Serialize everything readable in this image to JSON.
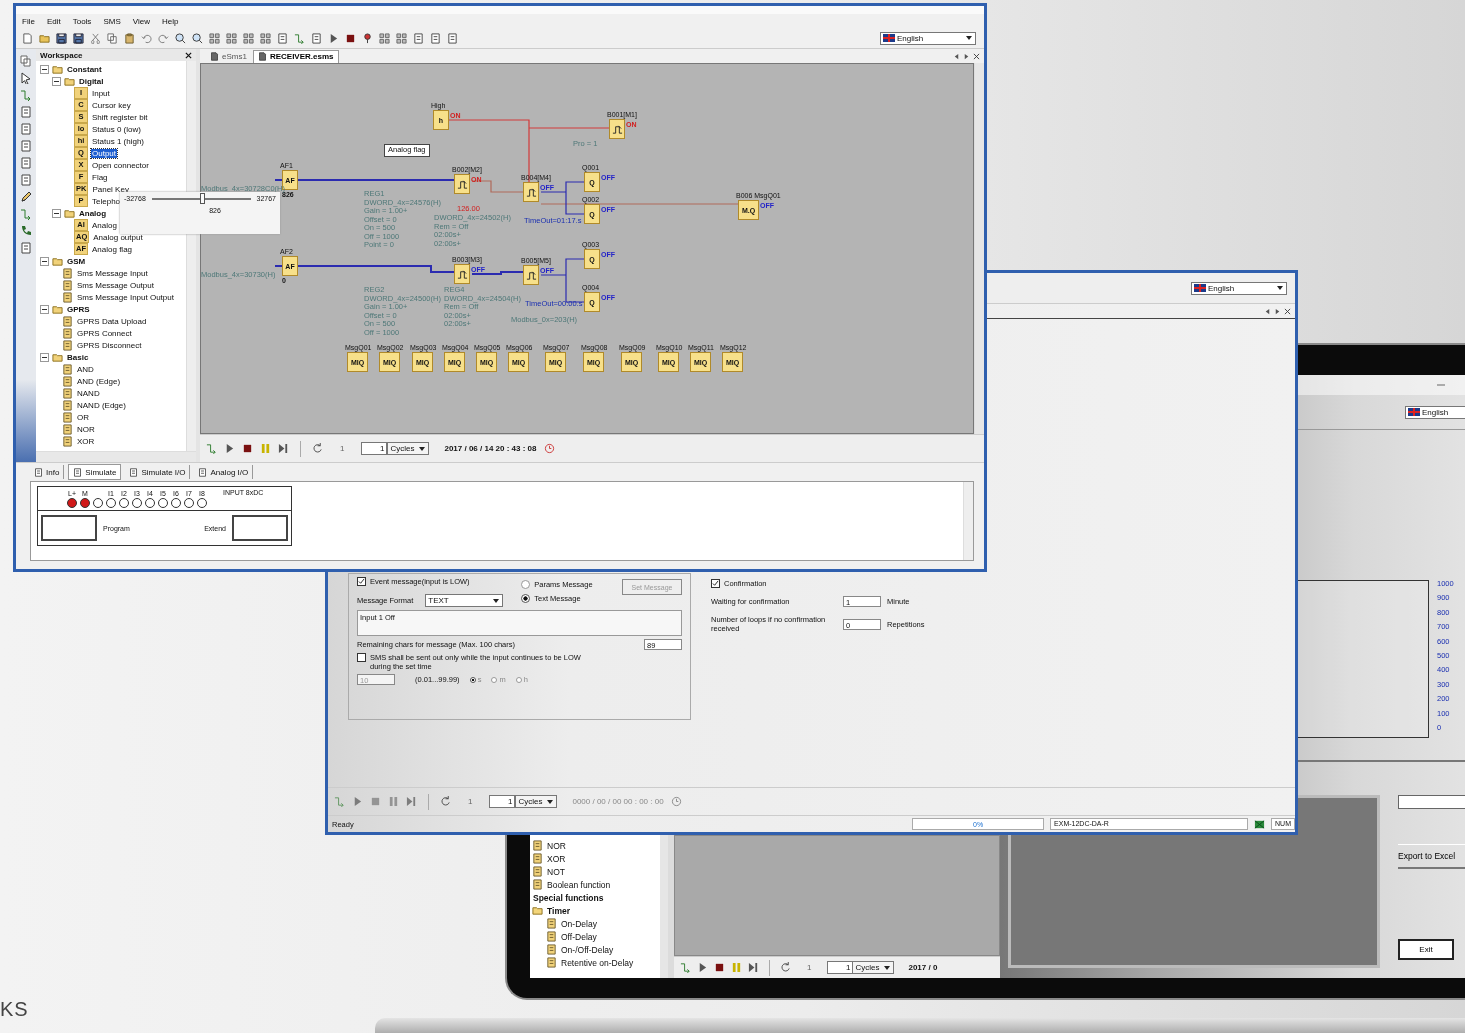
{
  "front_window": {
    "menu": [
      "File",
      "Edit",
      "Tools",
      "SMS",
      "View",
      "Help"
    ],
    "language": "English",
    "workspace": {
      "title": "Workspace",
      "tree": [
        {
          "kind": "folder",
          "label": "Constant",
          "expanded": true,
          "children": [
            {
              "kind": "folder",
              "label": "Digital",
              "expanded": true,
              "children": [
                {
                  "kind": "leaf",
                  "badge": "I",
                  "label": "Input",
                  "selected": false
                },
                {
                  "kind": "leaf",
                  "badge": "C",
                  "label": "Cursor key",
                  "selected": false
                },
                {
                  "kind": "leaf",
                  "badge": "S",
                  "label": "Shift register bit",
                  "selected": false
                },
                {
                  "kind": "leaf",
                  "badge": "lo",
                  "label": "Status 0 (low)",
                  "selected": false
                },
                {
                  "kind": "leaf",
                  "badge": "hi",
                  "label": "Status 1 (high)",
                  "selected": false
                },
                {
                  "kind": "leaf",
                  "badge": "Q",
                  "label": "Output",
                  "selected": true
                },
                {
                  "kind": "leaf",
                  "badge": "X",
                  "label": "Open connector",
                  "selected": false
                },
                {
                  "kind": "leaf",
                  "badge": "F",
                  "label": "Flag",
                  "selected": false
                },
                {
                  "kind": "leaf",
                  "badge": "PK",
                  "label": "Panel Key",
                  "selected": false
                },
                {
                  "kind": "leaf",
                  "badge": "P",
                  "label": "Telepho",
                  "selected": false
                }
              ]
            },
            {
              "kind": "folder",
              "label": "Analog",
              "expanded": true,
              "children": [
                {
                  "kind": "leaf",
                  "badge": "AI",
                  "label": "Analog",
                  "selected": false
                },
                {
                  "kind": "leaf",
                  "badge": "AQ",
                  "label": "Analog output",
                  "selected": false
                },
                {
                  "kind": "leaf",
                  "badge": "AF",
                  "label": "Analog flag",
                  "selected": false
                }
              ]
            }
          ]
        },
        {
          "kind": "folder",
          "label": "GSM",
          "expanded": true,
          "children": [
            {
              "kind": "leaf",
              "label": "Sms Message Input",
              "selected": false
            },
            {
              "kind": "leaf",
              "label": "Sms Message Output",
              "selected": false
            },
            {
              "kind": "leaf",
              "label": "Sms Message Input Output",
              "selected": false
            }
          ]
        },
        {
          "kind": "folder",
          "label": "GPRS",
          "expanded": true,
          "children": [
            {
              "kind": "leaf",
              "label": "GPRS Data Upload",
              "selected": false
            },
            {
              "kind": "leaf",
              "label": "GPRS Connect",
              "selected": false
            },
            {
              "kind": "leaf",
              "label": "GPRS Disconnect",
              "selected": false
            }
          ]
        },
        {
          "kind": "folder",
          "label": "Basic",
          "expanded": true,
          "children": [
            {
              "kind": "leaf",
              "label": "AND",
              "selected": false
            },
            {
              "kind": "leaf",
              "label": "AND (Edge)",
              "selected": false
            },
            {
              "kind": "leaf",
              "label": "NAND",
              "selected": false
            },
            {
              "kind": "leaf",
              "label": "NAND (Edge)",
              "selected": false
            },
            {
              "kind": "leaf",
              "label": "OR",
              "selected": false
            },
            {
              "kind": "leaf",
              "label": "NOR",
              "selected": false
            },
            {
              "kind": "leaf",
              "label": "XOR",
              "selected": false
            }
          ]
        }
      ]
    },
    "slider_popup": {
      "min": "-32768",
      "max": "32767",
      "value": "826",
      "level": 0.51
    },
    "doc_tabs": [
      {
        "label": "eSms1",
        "selected": false
      },
      {
        "label": "RECEIVER.esms",
        "selected": true
      }
    ],
    "nodes": [
      {
        "kind": "block",
        "title": "High",
        "symbol": "h",
        "state": "ON",
        "on": true
      },
      {
        "kind": "pulse",
        "title": "B001[M1]",
        "state": "ON",
        "on": true
      },
      {
        "kind": "block",
        "title": "AF1",
        "symbol": "AF",
        "value": "826"
      },
      {
        "kind": "pulse",
        "title": "B002[M2]",
        "state": "ON",
        "on": true
      },
      {
        "kind": "pulse",
        "title": "B004[M4]",
        "state": "OFF",
        "on": false
      },
      {
        "kind": "block",
        "title": "Q001",
        "symbol": "Q",
        "state": "OFF",
        "on": false
      },
      {
        "kind": "block",
        "title": "Q002",
        "symbol": "Q",
        "state": "OFF",
        "on": false
      },
      {
        "kind": "block",
        "title": "B006 MsgQ01",
        "symbol": "M.Q",
        "state": "OFF",
        "on": false
      },
      {
        "kind": "block",
        "title": "AF2",
        "symbol": "AF",
        "value": "0"
      },
      {
        "kind": "pulse",
        "title": "B003[M3]",
        "state": "OFF",
        "on": false
      },
      {
        "kind": "pulse",
        "title": "B005[M5]",
        "state": "OFF",
        "on": false
      },
      {
        "kind": "block",
        "title": "Q003",
        "symbol": "Q",
        "state": "OFF",
        "on": false
      },
      {
        "kind": "block",
        "title": "Q004",
        "symbol": "Q",
        "state": "OFF",
        "on": false
      },
      {
        "kind": "block",
        "title": "MsgQ01",
        "symbol": "MIQ"
      },
      {
        "kind": "block",
        "title": "MsgQ02",
        "symbol": "MIQ"
      },
      {
        "kind": "block",
        "title": "MsgQ03",
        "symbol": "MIQ"
      },
      {
        "kind": "block",
        "title": "MsgQ04",
        "symbol": "MIQ"
      },
      {
        "kind": "block",
        "title": "MsgQ05",
        "symbol": "MIQ"
      },
      {
        "kind": "block",
        "title": "MsgQ06",
        "symbol": "MIQ"
      },
      {
        "kind": "block",
        "title": "MsgQ07",
        "symbol": "MIQ"
      },
      {
        "kind": "block",
        "title": "MsgQ08",
        "symbol": "MIQ"
      },
      {
        "kind": "block",
        "title": "MsgQ09",
        "symbol": "MIQ"
      },
      {
        "kind": "block",
        "title": "MsgQ10",
        "symbol": "MIQ"
      },
      {
        "kind": "block",
        "title": "MsgQ11",
        "symbol": "MIQ"
      },
      {
        "kind": "block",
        "title": "MsgQ12",
        "symbol": "MIQ"
      }
    ],
    "notes": [
      {
        "kind": "tooltip",
        "lines": [
          "Analog flag"
        ]
      },
      {
        "kind": "param",
        "lines": [
          "Modbus_4x=30728C0(H)"
        ]
      },
      {
        "kind": "param",
        "lines": [
          "REG1",
          "DWORD_4x=24576(H)",
          "Gain = 1.00+",
          "Offset = 0",
          "On = 500",
          "Off = 1000",
          "Point = 0"
        ]
      },
      {
        "kind": "alert",
        "lines": [
          "126.00"
        ]
      },
      {
        "kind": "param",
        "lines": [
          "DWORD_4x=24502(H)",
          "Rem = Off",
          "02:00s+",
          "02:00s+"
        ]
      },
      {
        "kind": "param",
        "lines": [
          "Pro = 1"
        ]
      },
      {
        "kind": "link",
        "lines": [
          "TimeOut=01:17.s"
        ]
      },
      {
        "kind": "param",
        "lines": [
          "Modbus_4x=30730(H)"
        ]
      },
      {
        "kind": "param",
        "lines": [
          "REG2",
          "DWORD_4x=24500(H)",
          "Gain = 1.00+",
          "Offset = 0",
          "On = 500",
          "Off = 1000"
        ]
      },
      {
        "kind": "param",
        "lines": [
          "REG4",
          "DWORD_4x=24504(H)",
          "Rem = Off",
          "02:00s+",
          "02:00s+"
        ]
      },
      {
        "kind": "link",
        "lines": [
          "TimeOut=00:00.s"
        ]
      },
      {
        "kind": "param",
        "lines": [
          "Modbus_0x=203(H)"
        ]
      }
    ],
    "sim_toolbar": {
      "step": "1",
      "cycles": "1",
      "unit": "Cycles",
      "datetime": "2017 / 06 / 14 20 : 43 : 08"
    },
    "bottom_tabs": [
      {
        "label": "Info",
        "selected": false
      },
      {
        "label": "Simulate",
        "selected": true
      },
      {
        "label": "Simulate I/O",
        "selected": false
      },
      {
        "label": "Analog I/O",
        "selected": false
      }
    ],
    "plc": {
      "header": "INPUT 8xDC",
      "inputs": [
        {
          "label": "L+",
          "on": true
        },
        {
          "label": "M",
          "on": true
        },
        {
          "on": false
        },
        {
          "label": "I1",
          "on": false
        },
        {
          "label": "I2",
          "on": false
        },
        {
          "label": "I3",
          "on": false
        },
        {
          "label": "I4",
          "on": false
        },
        {
          "label": "I5",
          "on": false
        },
        {
          "label": "I6",
          "on": false
        },
        {
          "label": "I7",
          "on": false
        },
        {
          "label": "I8",
          "on": false
        }
      ],
      "left_slot": "Program",
      "right_slot": "Extend"
    }
  },
  "sms_window": {
    "language": "English",
    "event_message": {
      "label": "Event message(input is LOW)",
      "checked": true
    },
    "format_label": "Message Format",
    "format_value": "TEXT",
    "message_types": [
      {
        "label": "Params Message",
        "selected": false
      },
      {
        "label": "Text Message",
        "selected": true
      }
    ],
    "set_message_button": {
      "label": "Set Message",
      "disabled": true
    },
    "message_text": "Input 1 Off",
    "remaining_label": "Remaining chars for message (Max. 100 chars)",
    "remaining_value": "89",
    "low_only": {
      "label": "SMS shall be sent out only while the input continues to be LOW during the set time",
      "checked": false
    },
    "duration": {
      "value": "10",
      "range": "(0.01...99.99)",
      "disabled": true
    },
    "units": [
      {
        "label": "s",
        "selected": true
      },
      {
        "label": "m",
        "selected": false
      },
      {
        "label": "h",
        "selected": false
      }
    ],
    "confirmation": {
      "label": "Confirmation",
      "checked": true
    },
    "wait_label": "Waiting for confirmation",
    "wait_value": "1",
    "wait_unit": "Minute",
    "loops_label": "Number of loops if no confirmation received",
    "loops_value": "0",
    "loops_unit": "Repetitions",
    "sim_toolbar": {
      "step": "1",
      "cycles": "1",
      "unit": "Cycles",
      "datetime": "0000 / 00 / 00 00 : 00 : 00"
    },
    "status": {
      "text": "Ready",
      "progress_text": "0%",
      "level": 0,
      "device": "EXM-12DC-DA-R",
      "indicator": "NUM"
    }
  },
  "laptop": {
    "left_tree": [
      {
        "kind": "leaf",
        "label": "NOR",
        "selected": false
      },
      {
        "kind": "leaf",
        "label": "XOR",
        "selected": false
      },
      {
        "kind": "leaf",
        "label": "NOT",
        "selected": false
      },
      {
        "kind": "leaf",
        "label": "Boolean function",
        "selected": false
      },
      {
        "kind": "heading",
        "label": "Special functions"
      },
      {
        "kind": "folder",
        "label": "Timer",
        "expanded": true,
        "children": [
          {
            "kind": "leaf",
            "label": "On-Delay",
            "selected": false
          },
          {
            "kind": "leaf",
            "label": "Off-Delay",
            "selected": false
          },
          {
            "kind": "leaf",
            "label": "On-/Off-Delay",
            "selected": false
          },
          {
            "kind": "leaf",
            "label": "Retentive on-Delay",
            "selected": false
          }
        ]
      }
    ],
    "sim_toolbar": {
      "step": "1",
      "cycles": "1",
      "unit": "Cycles",
      "datetime": "2017 / 0"
    },
    "chart_window": {
      "language": "English",
      "axis_labels": [
        "1000",
        "900",
        "800",
        "700",
        "600",
        "500",
        "400",
        "300",
        "200",
        "100",
        "0"
      ],
      "export_button": "Export to Excel",
      "exit_button": "Exit"
    }
  },
  "page_caption": "KS"
}
